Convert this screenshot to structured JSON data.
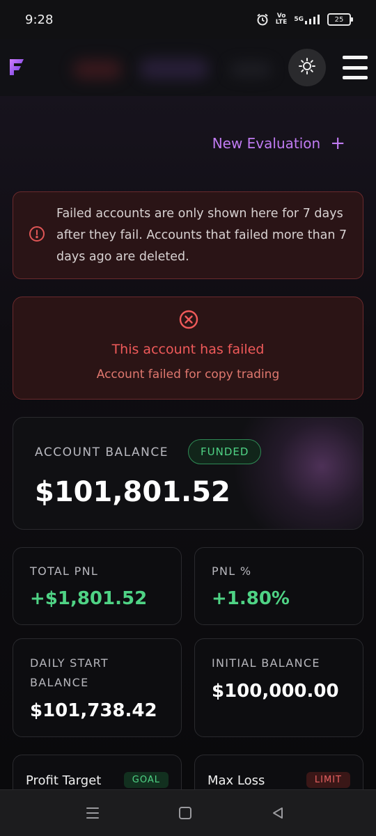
{
  "status_bar": {
    "time": "9:28",
    "network_top": "Vo",
    "network_bottom": "LTE",
    "signal_label": "5G",
    "battery": "25"
  },
  "header": {
    "logo": "F-logo",
    "theme_icon": "sun-icon",
    "menu_icon": "hamburger-icon"
  },
  "actions": {
    "new_evaluation": "New Evaluation",
    "plus": "+"
  },
  "notice": {
    "text": "Failed accounts are only shown here for 7 days after they fail. Accounts that failed more than 7 days ago are deleted."
  },
  "failure": {
    "title": "This account has failed",
    "subtitle": "Account failed for copy trading"
  },
  "balance": {
    "label": "ACCOUNT BALANCE",
    "badge": "FUNDED",
    "value": "$101,801.52"
  },
  "stats": {
    "total_pnl_label": "TOTAL PNL",
    "total_pnl_value": "+$1,801.52",
    "pnl_pct_label": "PNL %",
    "pnl_pct_value": "+1.80%",
    "daily_start_label_1": "DAILY START",
    "daily_start_label_2": "BALANCE",
    "daily_start_value": "$101,738.42",
    "initial_balance_label": "INITIAL BALANCE",
    "initial_balance_value": "$100,000.00"
  },
  "bottom_cards": {
    "profit_target_label": "Profit Target",
    "profit_target_tag": "GOAL",
    "max_loss_label": "Max Loss",
    "max_loss_tag": "LIMIT"
  },
  "colors": {
    "accent": "#c07bf2",
    "success": "#4fd385",
    "danger": "#f05a5a"
  }
}
